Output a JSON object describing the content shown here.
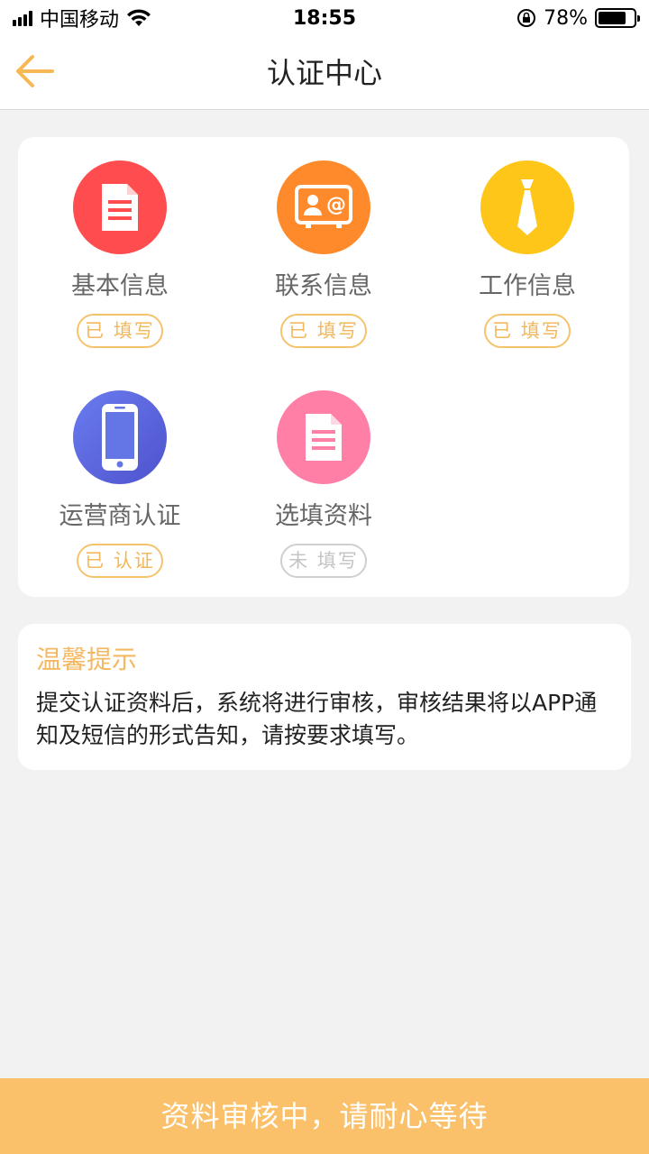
{
  "status_bar": {
    "carrier": "中国移动",
    "time": "18:55",
    "battery_percent": "78%",
    "battery_level": 0.78
  },
  "navbar": {
    "title": "认证中心",
    "back_icon": "arrow-left-icon",
    "accent": "#f7b955"
  },
  "items": [
    {
      "label": "基本信息",
      "status": "已 填写",
      "icon": "document-icon",
      "color": "#ff4d4f",
      "filled": true
    },
    {
      "label": "联系信息",
      "status": "已 填写",
      "icon": "contact-card-icon",
      "color": "#ff8a2b",
      "filled": true
    },
    {
      "label": "工作信息",
      "status": "已 填写",
      "icon": "tie-icon",
      "color": "#ffc61a",
      "filled": true
    },
    {
      "label": "运营商认证",
      "status": "已 认证",
      "icon": "phone-icon",
      "color": "#5d6ee0",
      "filled": true
    },
    {
      "label": "选填资料",
      "status": "未 填写",
      "icon": "document-icon",
      "color": "#ff7fa6",
      "filled": false
    }
  ],
  "tips": {
    "title": "温馨提示",
    "body": "提交认证资料后，系统将进行审核，审核结果将以APP通知及短信的形式告知，请按要求填写。"
  },
  "bottom_button": {
    "label": "资料审核中，请耐心等待",
    "color": "#fbc16a"
  }
}
